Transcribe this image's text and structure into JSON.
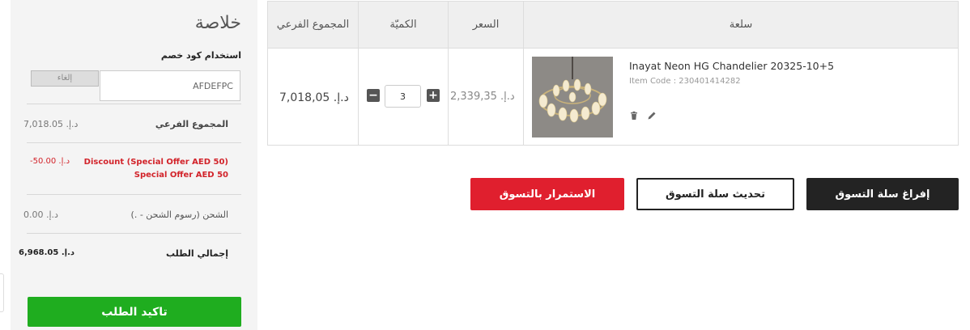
{
  "summary": {
    "title": "خلاصة",
    "coupon_label": "استخدام كود خصم",
    "coupon_value": "AFDEFPC",
    "cancel_label": "إلغاء",
    "subtotal_label": "المجموع الفرعي",
    "subtotal_value": "د.إ. 7,018.05",
    "discount_label_1": "Discount (Special Offer AED 50)",
    "discount_label_2": "Special Offer AED 50",
    "discount_value": "-د.إ. 50.00",
    "shipping_label": "الشحن (رسوم الشحن - .)",
    "shipping_value": "د.إ. 0.00",
    "total_label": "إجمالي الطلب",
    "total_value": "د.إ. 6,968.05",
    "confirm_label": "تاكيد الطلب"
  },
  "cart": {
    "headers": {
      "item": "سلعة",
      "price": "السعر",
      "qty": "الكميّة",
      "subtotal": "المجموع الفرعي"
    },
    "rows": [
      {
        "name": "Inayat Neon HG Chandelier 20325-10+5",
        "code": "Item Code : 230401414282",
        "price": "د.إ. 2,339,35",
        "qty": "3",
        "subtotal": "د.إ. 7,018,05"
      }
    ]
  },
  "actions": {
    "empty_cart": "إفراغ سلة التسوق",
    "update_cart": "تحديث سلة التسوق",
    "continue_shopping": "الاستمرار بالتسوق"
  },
  "colors": {
    "accent_red": "#e01f2e",
    "confirm_green": "#1fad1f",
    "dark_button": "#232323"
  }
}
